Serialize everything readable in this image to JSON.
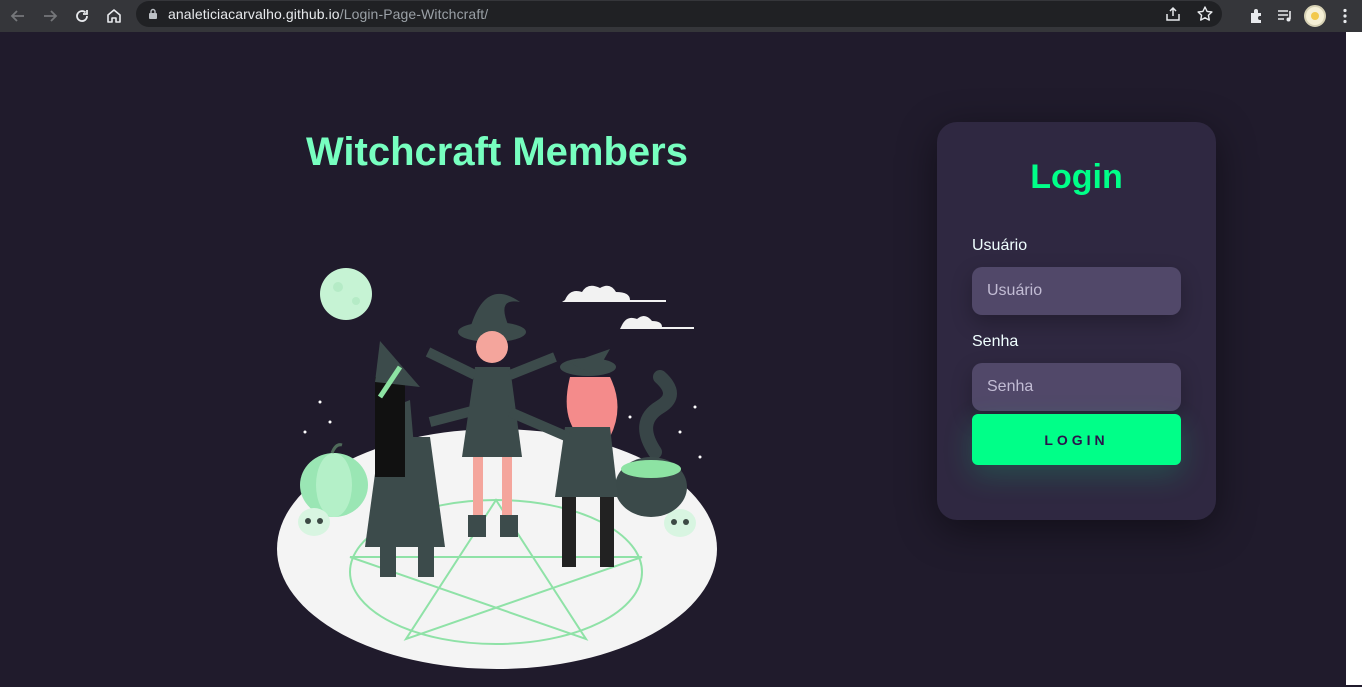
{
  "browser": {
    "url_domain": "analeticiacarvalho.github.io",
    "url_path": "/Login-Page-Witchcraft/",
    "icons": [
      "back-icon",
      "forward-icon",
      "reload-icon",
      "home-icon",
      "lock-icon",
      "share-icon",
      "star-icon",
      "extensions-icon",
      "media-icon",
      "profile-avatar",
      "menu-icon"
    ]
  },
  "page": {
    "title": "Witchcraft Members"
  },
  "login": {
    "title": "Login",
    "username_label": "Usuário",
    "username_placeholder": "Usuário",
    "password_label": "Senha",
    "password_placeholder": "Senha",
    "button_label": "LOGIN"
  },
  "colors": {
    "background": "#201b2c",
    "accent": "#00ff88",
    "title": "#77ffc0",
    "card": "#2f2841",
    "input": "#514869"
  }
}
